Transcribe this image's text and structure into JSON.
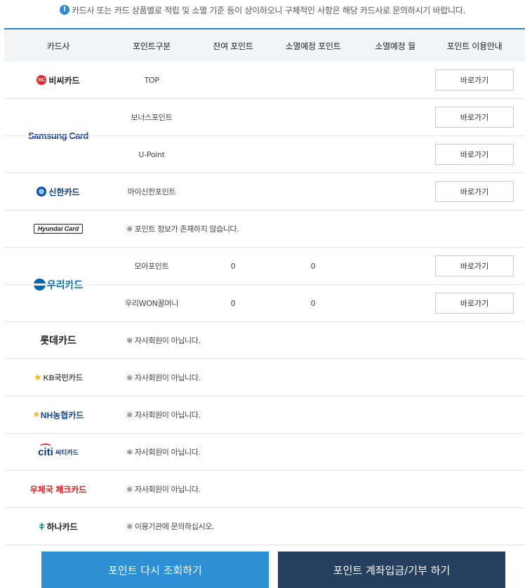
{
  "notice": {
    "icon": "info-icon",
    "text": "카드사 또는 카드 상품별로 적립 및 소멸 기준 등이 상이하오니 구체적인 사항은 해당 카드사로 문의하시기 바랍니다."
  },
  "table": {
    "headers": [
      "카드사",
      "포인트구분",
      "잔여 포인트",
      "소멸예정 포인트",
      "소멸예정 월",
      "포인트 이용안내"
    ],
    "go_label": "바로가기",
    "groups": [
      {
        "logo": {
          "mark": "BC",
          "text": "비씨카드"
        },
        "rows": [
          {
            "type": "TOP",
            "remaining": "",
            "expiring": "",
            "month": ""
          }
        ]
      },
      {
        "logo": {
          "text": "Samsung Card"
        },
        "rows": [
          {
            "type": "보너스포인트",
            "remaining": "",
            "expiring": "",
            "month": ""
          },
          {
            "type": "U-Point",
            "remaining": "",
            "expiring": "",
            "month": ""
          }
        ]
      },
      {
        "logo": {
          "text": "신한카드"
        },
        "rows": [
          {
            "type": "마이신한포인트",
            "remaining": "",
            "expiring": "",
            "month": ""
          }
        ]
      },
      {
        "logo": {
          "text": "Hyundai Card"
        },
        "message": "※ 포인트 정보가 존재하지 않습니다."
      },
      {
        "logo": {
          "text": "우리카드"
        },
        "rows": [
          {
            "type": "모아포인트",
            "remaining": "0",
            "expiring": "0",
            "month": ""
          },
          {
            "type": "우리WON꿀머니",
            "remaining": "0",
            "expiring": "0",
            "month": ""
          }
        ]
      },
      {
        "logo": {
          "text": "롯데카드"
        },
        "message": "※ 자사회원이 아닙니다."
      },
      {
        "logo": {
          "mark": "★",
          "text": "KB국민카드"
        },
        "message": "※ 자사회원이 아닙니다."
      },
      {
        "logo": {
          "mark": "✶",
          "text": "NH농협카드"
        },
        "message": "※ 자사회원이 아닙니다."
      },
      {
        "logo": {
          "text": "citi",
          "sub": "씨티카드"
        },
        "message": "※ 자사회원이 아닙니다."
      },
      {
        "logo": {
          "text": "우체국 체크카드"
        },
        "message": "※ 자사회원이 아닙니다."
      },
      {
        "logo": {
          "mark": "ǂ",
          "text": "하나카드"
        },
        "message": "※ 이용기관에 문의하십시오."
      }
    ]
  },
  "footer": {
    "reload_label": "포인트 다시 조회하기",
    "deposit_label": "포인트 계좌입금/기부 하기"
  },
  "colors": {
    "accent": "#2b86c9",
    "reload_button": "#2e8fd5",
    "deposit_button": "#253f5e"
  }
}
